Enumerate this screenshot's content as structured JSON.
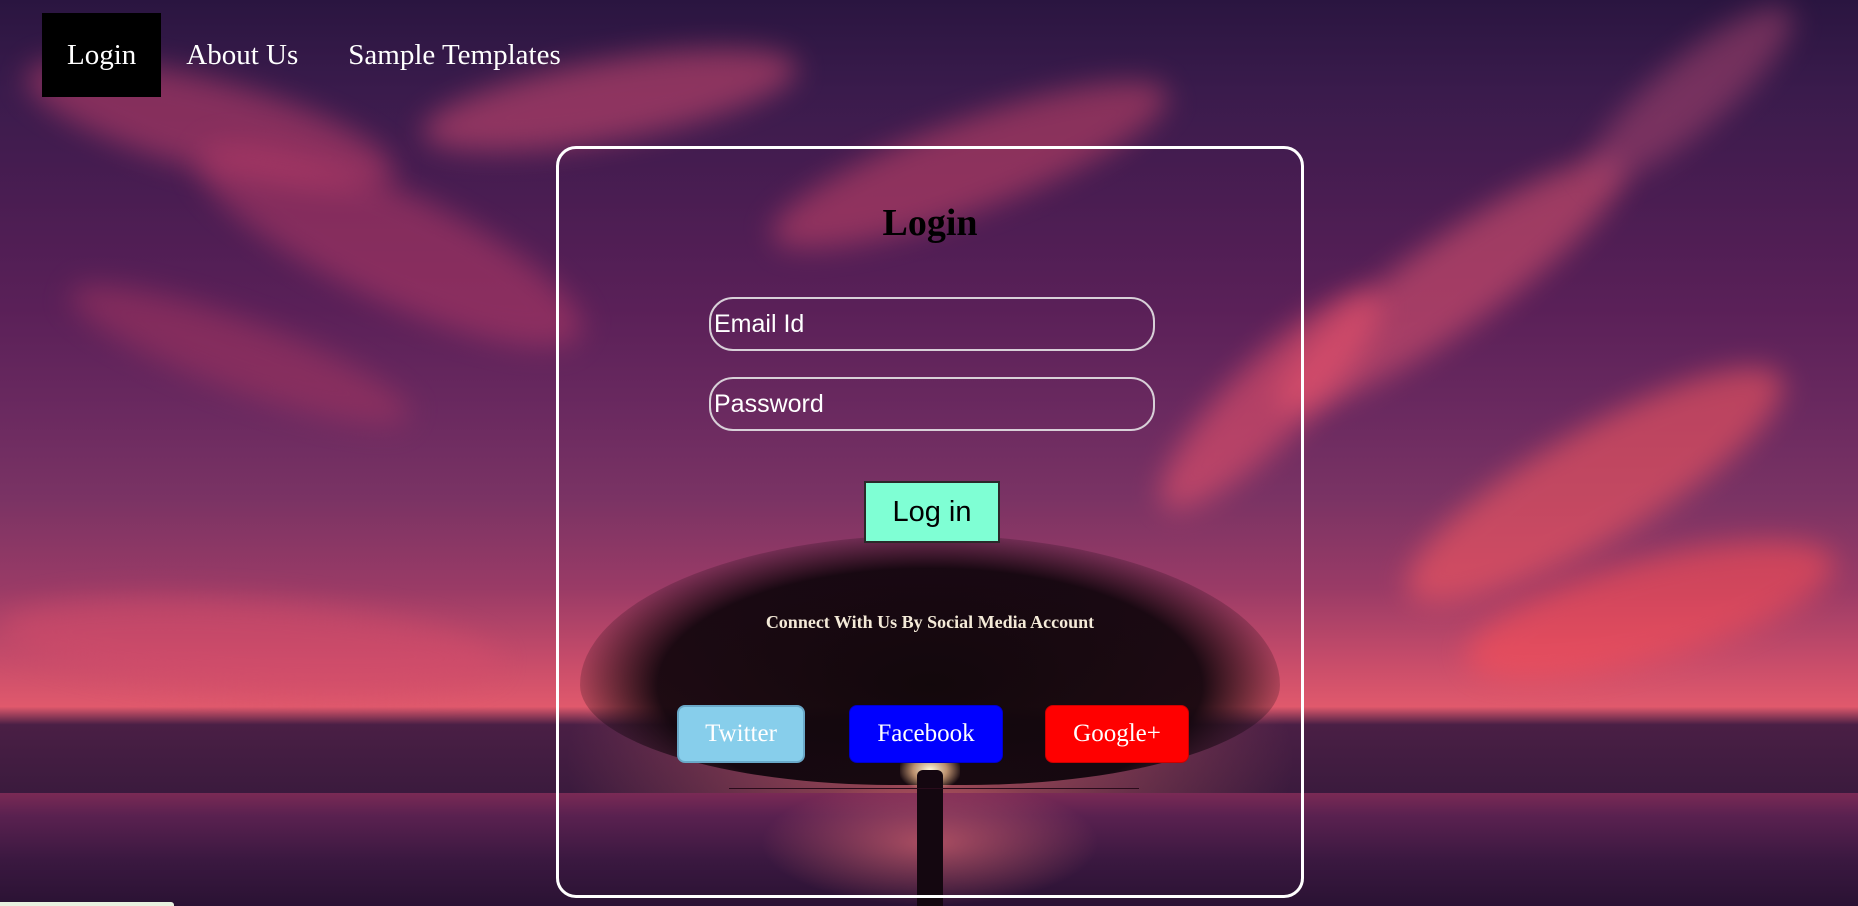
{
  "nav": {
    "items": [
      {
        "label": "Login",
        "active": true
      },
      {
        "label": "About Us",
        "active": false
      },
      {
        "label": "Sample Templates",
        "active": false
      }
    ]
  },
  "login_form": {
    "title": "Login",
    "email_placeholder": "Email Id",
    "password_placeholder": "Password",
    "submit_label": "Log in",
    "social_text": "Connect With Us By Social Media Account",
    "social_buttons": [
      {
        "label": "Twitter",
        "color": "#87ceeb"
      },
      {
        "label": "Facebook",
        "color": "#0000ff"
      },
      {
        "label": "Google+",
        "color": "#ff0000"
      }
    ]
  },
  "colors": {
    "nav_active_bg": "#000000",
    "login_button_bg": "#7fffd4",
    "card_border": "#ffffff"
  }
}
